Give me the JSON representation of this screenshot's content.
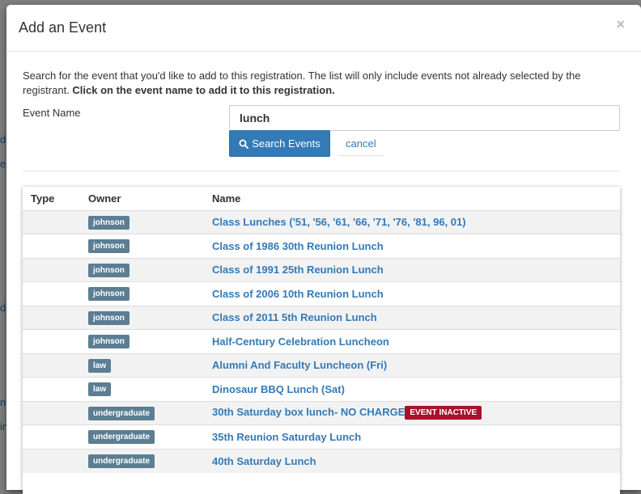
{
  "background": {
    "fragments": [
      "d",
      "e",
      "ds",
      "nc",
      "in"
    ]
  },
  "modal": {
    "title": "Add an Event",
    "close_glyph": "×",
    "intro_text": "Search for the event that you'd like to add to this registration. The list will only include events not already selected by the registrant. ",
    "intro_bold": "Click on the event name to add it to this registration."
  },
  "search": {
    "label": "Event Name",
    "value": "lunch",
    "button_label": "Search Events",
    "cancel_label": "cancel"
  },
  "table": {
    "headers": {
      "type": "Type",
      "owner": "Owner",
      "name": "Name"
    },
    "rows": [
      {
        "type": "",
        "owner": "johnson",
        "name": "Class Lunches ('51, '56, '61, '66, '71, '76, '81, 96, 01)"
      },
      {
        "type": "",
        "owner": "johnson",
        "name": "Class of 1986 30th Reunion Lunch"
      },
      {
        "type": "",
        "owner": "johnson",
        "name": "Class of 1991 25th Reunion Lunch"
      },
      {
        "type": "",
        "owner": "johnson",
        "name": "Class of 2006 10th Reunion Lunch"
      },
      {
        "type": "",
        "owner": "johnson",
        "name": "Class of 2011 5th Reunion Lunch"
      },
      {
        "type": "",
        "owner": "johnson",
        "name": "Half-Century Celebration Luncheon"
      },
      {
        "type": "",
        "owner": "law",
        "name": "Alumni And Faculty Luncheon (Fri)"
      },
      {
        "type": "",
        "owner": "law",
        "name": "Dinosaur BBQ Lunch (Sat)"
      },
      {
        "type": "",
        "owner": "undergraduate",
        "name": "30th Saturday box lunch- NO CHARGE",
        "status": "EVENT INACTIVE"
      },
      {
        "type": "",
        "owner": "undergraduate",
        "name": "35th Reunion Saturday Lunch"
      },
      {
        "type": "",
        "owner": "undergraduate",
        "name": "40th Saturday Lunch"
      }
    ]
  },
  "colors": {
    "primary": "#337ab7",
    "owner_badge": "#5c7e93",
    "inactive_badge": "#a5122a"
  }
}
